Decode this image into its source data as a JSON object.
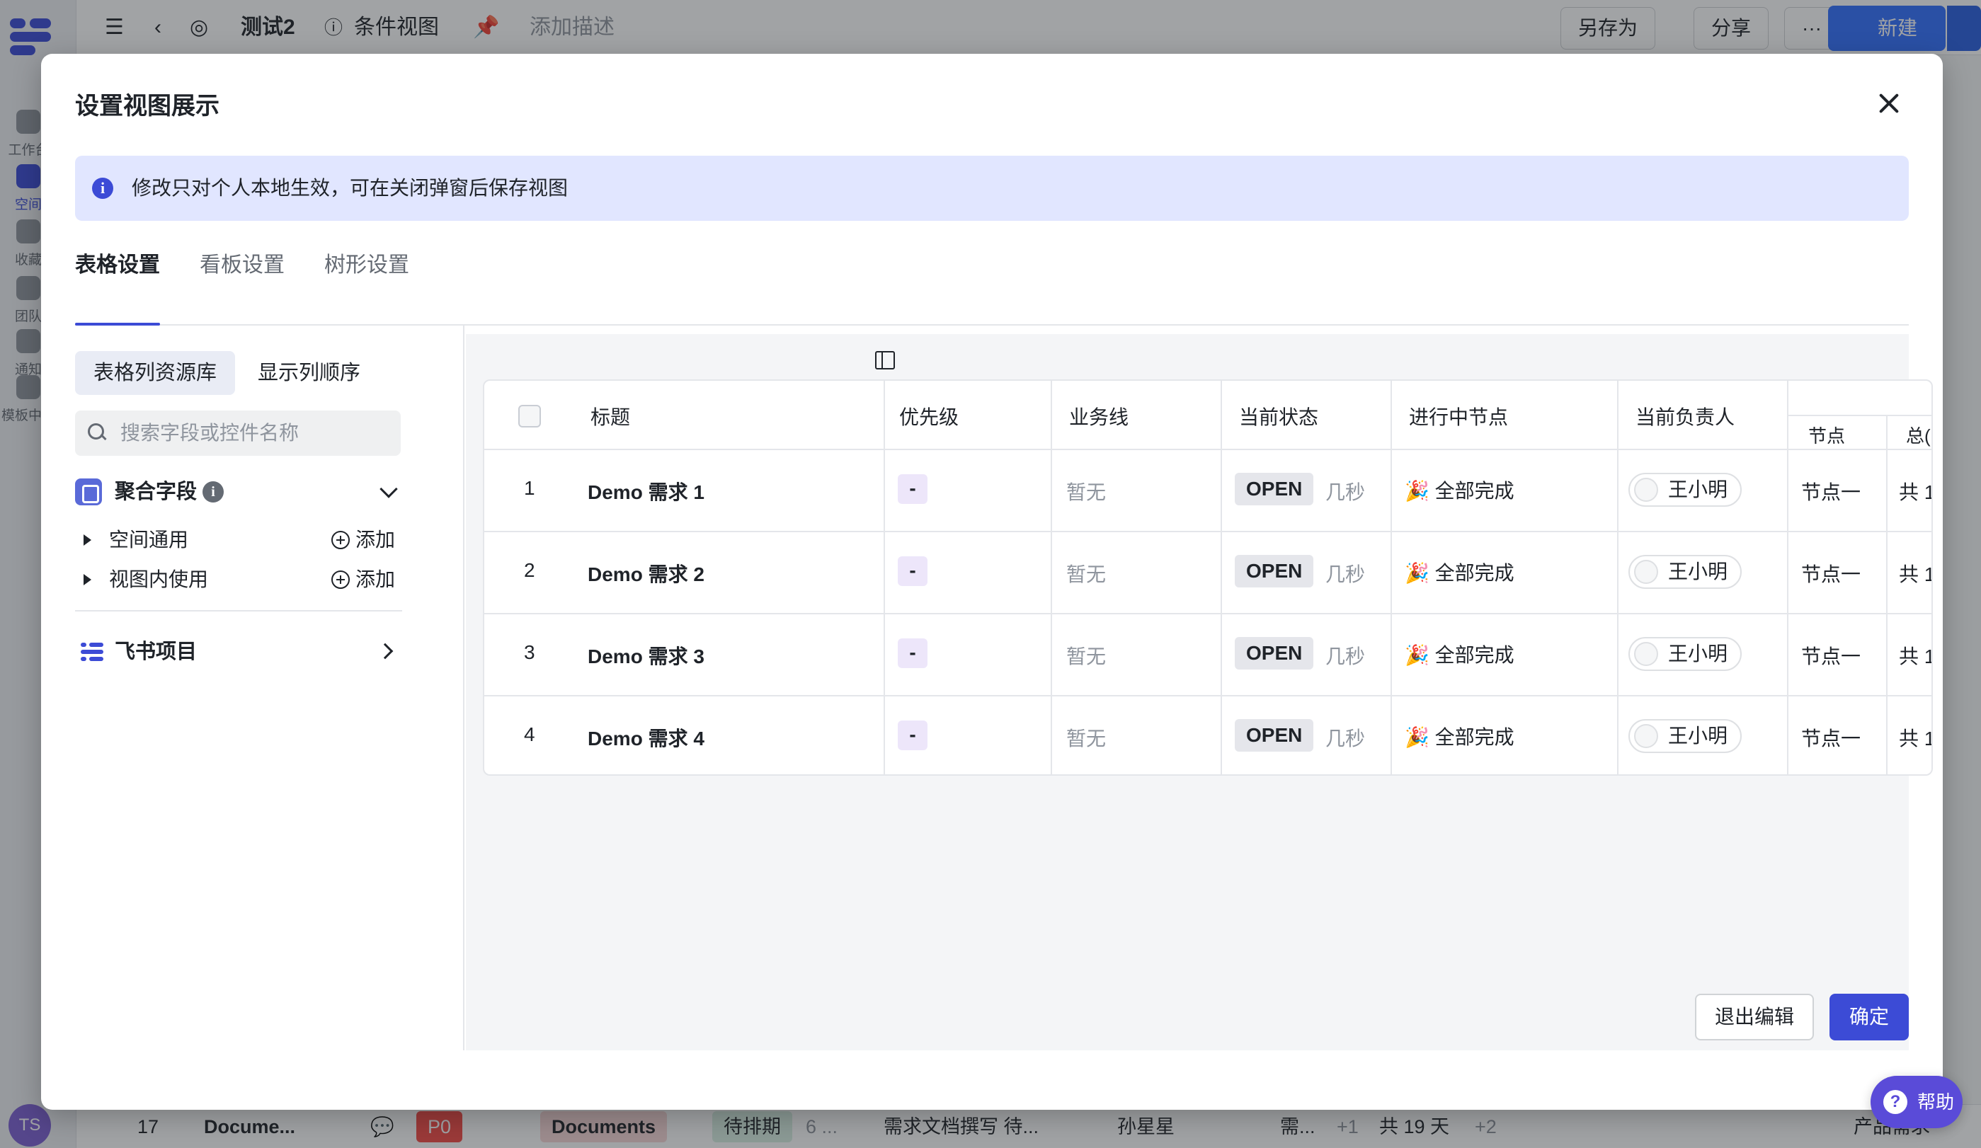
{
  "background": {
    "rail": {
      "items": [
        "工作台",
        "空间",
        "收藏",
        "团队",
        "通知",
        "模板中心"
      ],
      "avatar": "TS"
    },
    "topbar": {
      "title": "测试2",
      "view_name": "条件视图",
      "add_desc": "添加描述",
      "save_as": "另存为",
      "share": "分享",
      "more": "···",
      "new": "新建"
    },
    "bottom_row": {
      "index": "17",
      "name": "Docume...",
      "priority": "P0",
      "business": "Documents",
      "status": "待排期",
      "time": "6 ...",
      "node": "需求文档撰写 待...",
      "owner": "孙星星",
      "extra1": "需...",
      "extra1_more": "+1",
      "duration": "共 19 天",
      "extra2_more": "+2",
      "tail": "产品需求"
    }
  },
  "modal": {
    "title": "设置视图展示",
    "notice": "修改只对个人本地生效，可在关闭弹窗后保存视图",
    "tabs": [
      "表格设置",
      "看板设置",
      "树形设置"
    ],
    "left_tabs": [
      "表格列资源库",
      "显示列顺序"
    ],
    "search_placeholder": "搜索字段或控件名称",
    "group_title": "聚合字段",
    "sub_items": [
      {
        "label": "空间通用",
        "action": "添加"
      },
      {
        "label": "视图内使用",
        "action": "添加"
      }
    ],
    "feishu_label": "飞书项目",
    "table": {
      "headers": {
        "title": "标题",
        "priority": "优先级",
        "business": "业务线",
        "status": "当前状态",
        "node": "进行中节点",
        "owner": "当前负责人",
        "node_col": "节点",
        "total_col": "总(",
        "sub_header": ""
      },
      "rows": [
        {
          "index": "1",
          "title": "Demo 需求 1",
          "priority": "-",
          "business": "暂无",
          "status": "OPEN",
          "time": "几秒",
          "node": "🎉 全部完成",
          "owner": "王小明",
          "node_col": "节点一",
          "total": "共 1"
        },
        {
          "index": "2",
          "title": "Demo 需求 2",
          "priority": "-",
          "business": "暂无",
          "status": "OPEN",
          "time": "几秒",
          "node": "🎉 全部完成",
          "owner": "王小明",
          "node_col": "节点一",
          "total": "共 1"
        },
        {
          "index": "3",
          "title": "Demo 需求 3",
          "priority": "-",
          "business": "暂无",
          "status": "OPEN",
          "time": "几秒",
          "node": "🎉 全部完成",
          "owner": "王小明",
          "node_col": "节点一",
          "total": "共 1"
        },
        {
          "index": "4",
          "title": "Demo 需求 4",
          "priority": "-",
          "business": "暂无",
          "status": "OPEN",
          "time": "几秒",
          "node": "🎉 全部完成",
          "owner": "王小明",
          "node_col": "节点一",
          "total": "共 1"
        }
      ]
    },
    "buttons": {
      "exit": "退出编辑",
      "confirm": "确定"
    }
  },
  "help": "帮助",
  "colors": {
    "accent": "#3c4bd6",
    "notice_bg": "#e1e6ff",
    "priority_bg": "#ede6fa",
    "overlay": "rgba(31,35,41,0.42)"
  }
}
